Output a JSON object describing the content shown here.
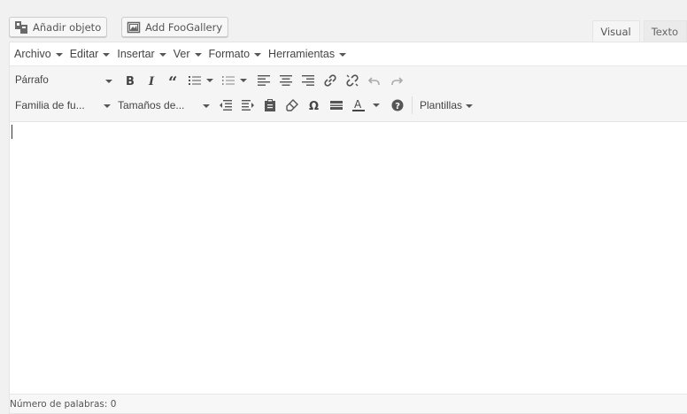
{
  "media_buttons": {
    "add_object": "Añadir objeto",
    "add_foogallery": "Add FooGallery"
  },
  "tabs": [
    {
      "label": "Visual"
    },
    {
      "label": "Texto"
    }
  ],
  "menubar": {
    "items": [
      "Archivo",
      "Editar",
      "Insertar",
      "Ver",
      "Formato",
      "Herramientas"
    ]
  },
  "toolbar": {
    "format_select": "Párrafo",
    "font_family_select": "Familia de fu...",
    "font_size_select": "Tamaños de...",
    "templates": "Plantillas"
  },
  "status": {
    "word_count": "Número de palabras: 0"
  }
}
